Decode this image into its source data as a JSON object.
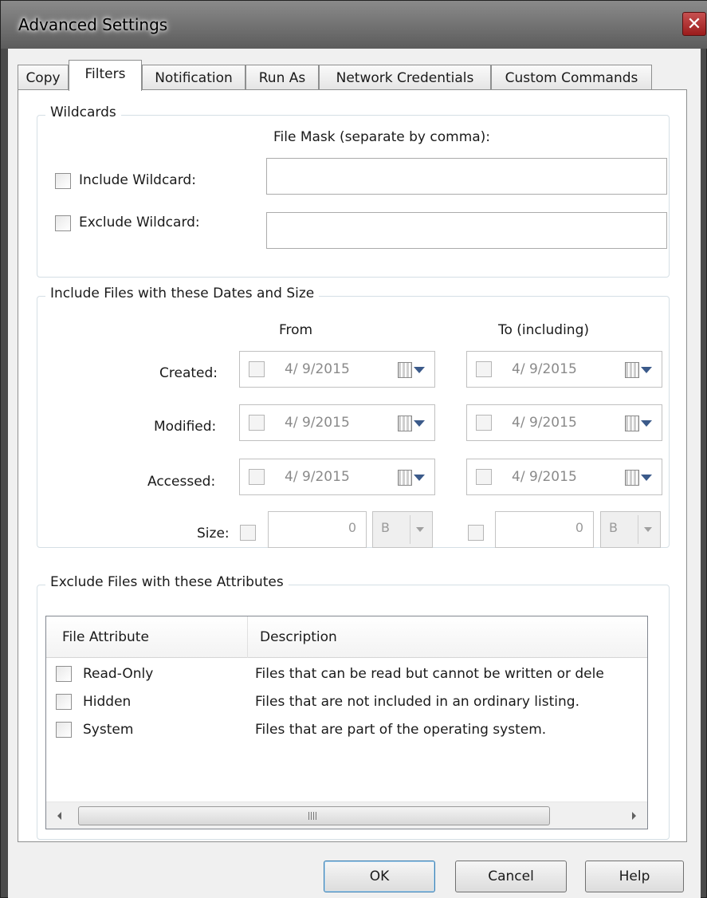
{
  "window": {
    "title": "Advanced Settings",
    "close_glyph": "✕"
  },
  "tabs": [
    {
      "label": "Copy",
      "active": false
    },
    {
      "label": "Filters",
      "active": true
    },
    {
      "label": "Notification",
      "active": false
    },
    {
      "label": "Run As",
      "active": false
    },
    {
      "label": "Network Credentials",
      "active": false
    },
    {
      "label": "Custom Commands",
      "active": false
    }
  ],
  "wildcards": {
    "group_title": "Wildcards",
    "mask_label": "File Mask (separate by comma):",
    "include_label": "Include Wildcard:",
    "include_value": "",
    "exclude_label": "Exclude Wildcard:",
    "exclude_value": ""
  },
  "dates": {
    "group_title": "Include Files with these Dates and Size",
    "from_label": "From",
    "to_label": "To (including)",
    "rows": [
      {
        "label": "Created:",
        "from": "4/ 9/2015",
        "to": "4/ 9/2015"
      },
      {
        "label": "Modified:",
        "from": "4/ 9/2015",
        "to": "4/ 9/2015"
      },
      {
        "label": "Accessed:",
        "from": "4/ 9/2015",
        "to": "4/ 9/2015"
      }
    ],
    "size": {
      "label": "Size:",
      "from_value": "0",
      "from_unit": "B",
      "to_value": "0",
      "to_unit": "B"
    },
    "calendar_icon": "calendar-dropdown-icon"
  },
  "attributes": {
    "group_title": "Exclude Files with these Attributes",
    "columns": [
      "File Attribute",
      "Description"
    ],
    "rows": [
      {
        "attr": "Read-Only",
        "desc": "Files that can be read but cannot be written or dele"
      },
      {
        "attr": "Hidden",
        "desc": "Files that are not included in an ordinary listing."
      },
      {
        "attr": "System",
        "desc": "Files that are part of the operating system."
      }
    ],
    "scroll_grip": "III"
  },
  "buttons": {
    "ok": "OK",
    "cancel": "Cancel",
    "help": "Help"
  }
}
